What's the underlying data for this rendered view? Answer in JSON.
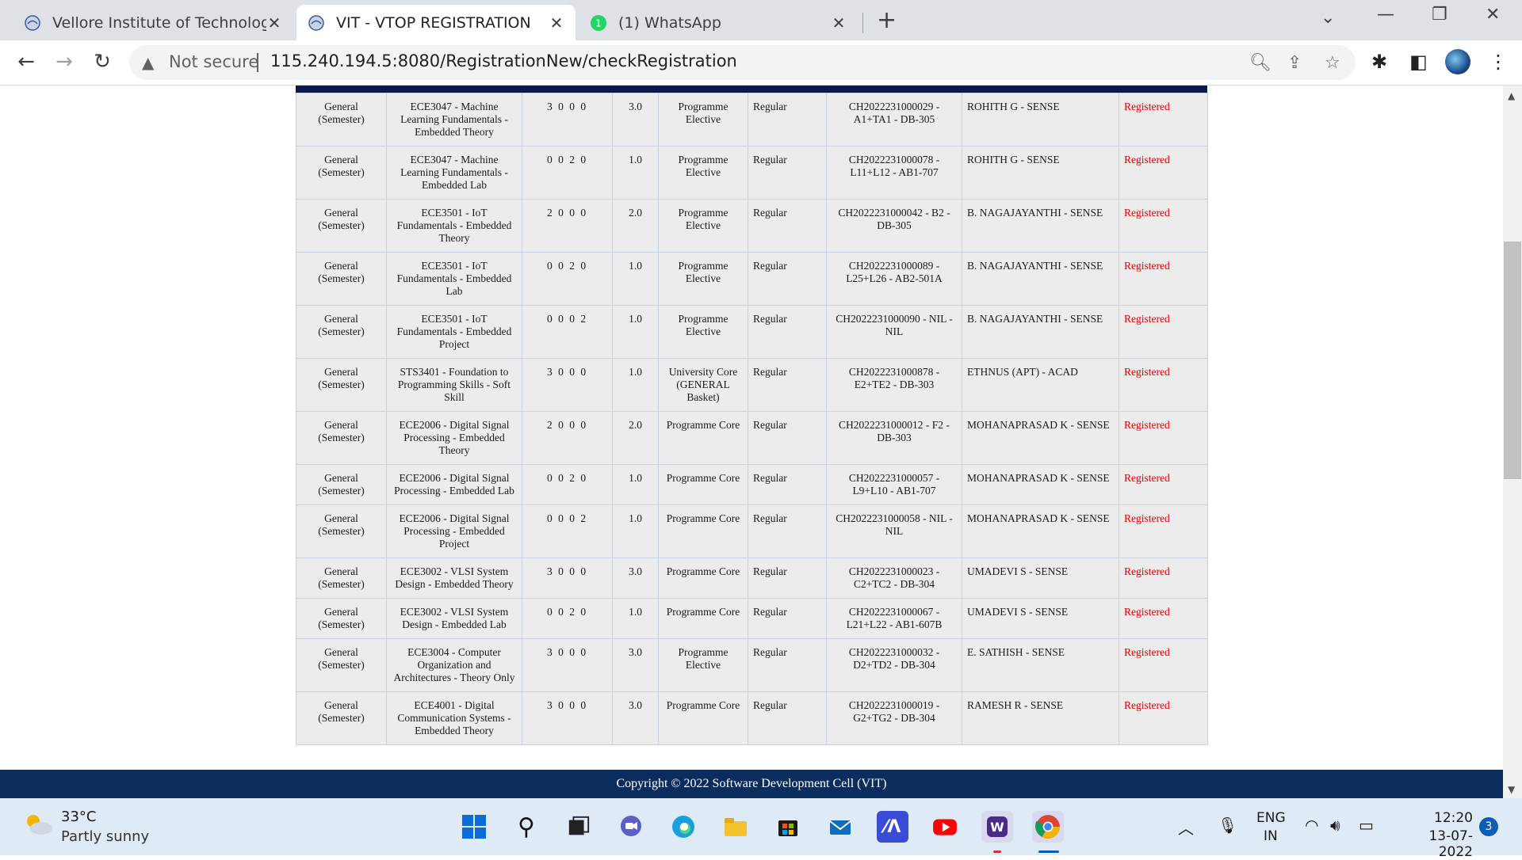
{
  "browser": {
    "tabs": [
      {
        "title": "Vellore Institute of Technology (V",
        "active": false
      },
      {
        "title": "VIT - VTOP REGISTRATION",
        "active": true
      },
      {
        "title": "(1) WhatsApp",
        "active": false,
        "badge": "1"
      }
    ],
    "new_tab": "+",
    "security_label": "Not secure",
    "url": "115.240.194.5:8080/RegistrationNew/checkRegistration"
  },
  "registration_rows": [
    {
      "type": "General (Semester)",
      "course": "ECE3047 - Machine Learning Fundamentals - Embedded Theory",
      "ltpjc": "3 0 0 0",
      "credits": "3.0",
      "category": "Programme Elective",
      "option": "Regular",
      "class": "CH2022231000029 - A1+TA1 - DB-305",
      "faculty": "ROHITH G - SENSE",
      "status": "Registered"
    },
    {
      "type": "General (Semester)",
      "course": "ECE3047 - Machine Learning Fundamentals - Embedded Lab",
      "ltpjc": "0 0 2 0",
      "credits": "1.0",
      "category": "Programme Elective",
      "option": "Regular",
      "class": "CH2022231000078 - L11+L12 - AB1-707",
      "faculty": "ROHITH G - SENSE",
      "status": "Registered"
    },
    {
      "type": "General (Semester)",
      "course": "ECE3501 - IoT Fundamentals - Embedded Theory",
      "ltpjc": "2 0 0 0",
      "credits": "2.0",
      "category": "Programme Elective",
      "option": "Regular",
      "class": "CH2022231000042 - B2 - DB-305",
      "faculty": "B. NAGAJAYANTHI - SENSE",
      "status": "Registered"
    },
    {
      "type": "General (Semester)",
      "course": "ECE3501 - IoT Fundamentals - Embedded Lab",
      "ltpjc": "0 0 2 0",
      "credits": "1.0",
      "category": "Programme Elective",
      "option": "Regular",
      "class": "CH2022231000089 - L25+L26 - AB2-501A",
      "faculty": "B. NAGAJAYANTHI - SENSE",
      "status": "Registered"
    },
    {
      "type": "General (Semester)",
      "course": "ECE3501 - IoT Fundamentals - Embedded Project",
      "ltpjc": "0 0 0 2",
      "credits": "1.0",
      "category": "Programme Elective",
      "option": "Regular",
      "class": "CH2022231000090 - NIL - NIL",
      "faculty": "B. NAGAJAYANTHI - SENSE",
      "status": "Registered"
    },
    {
      "type": "General (Semester)",
      "course": "STS3401 - Foundation to Programming Skills - Soft Skill",
      "ltpjc": "3 0 0 0",
      "credits": "1.0",
      "category": "University Core (GENERAL Basket)",
      "option": "Regular",
      "class": "CH2022231000878 - E2+TE2 - DB-303",
      "faculty": "ETHNUS (APT) - ACAD",
      "status": "Registered"
    },
    {
      "type": "General (Semester)",
      "course": "ECE2006 - Digital Signal Processing - Embedded Theory",
      "ltpjc": "2 0 0 0",
      "credits": "2.0",
      "category": "Programme Core",
      "option": "Regular",
      "class": "CH2022231000012 - F2 - DB-303",
      "faculty": "MOHANAPRASAD K - SENSE",
      "status": "Registered"
    },
    {
      "type": "General (Semester)",
      "course": "ECE2006 - Digital Signal Processing - Embedded Lab",
      "ltpjc": "0 0 2 0",
      "credits": "1.0",
      "category": "Programme Core",
      "option": "Regular",
      "class": "CH2022231000057 - L9+L10 - AB1-707",
      "faculty": "MOHANAPRASAD K - SENSE",
      "status": "Registered"
    },
    {
      "type": "General (Semester)",
      "course": "ECE2006 - Digital Signal Processing - Embedded Project",
      "ltpjc": "0 0 0 2",
      "credits": "1.0",
      "category": "Programme Core",
      "option": "Regular",
      "class": "CH2022231000058 - NIL - NIL",
      "faculty": "MOHANAPRASAD K - SENSE",
      "status": "Registered"
    },
    {
      "type": "General (Semester)",
      "course": "ECE3002 - VLSI System Design - Embedded Theory",
      "ltpjc": "3 0 0 0",
      "credits": "3.0",
      "category": "Programme Core",
      "option": "Regular",
      "class": "CH2022231000023 - C2+TC2 - DB-304",
      "faculty": "UMADEVI S - SENSE",
      "status": "Registered"
    },
    {
      "type": "General (Semester)",
      "course": "ECE3002 - VLSI System Design - Embedded Lab",
      "ltpjc": "0 0 2 0",
      "credits": "1.0",
      "category": "Programme Core",
      "option": "Regular",
      "class": "CH2022231000067 - L21+L22 - AB1-607B",
      "faculty": "UMADEVI S - SENSE",
      "status": "Registered"
    },
    {
      "type": "General (Semester)",
      "course": "ECE3004 - Computer Organization and Architectures - Theory Only",
      "ltpjc": "3 0 0 0",
      "credits": "3.0",
      "category": "Programme Elective",
      "option": "Regular",
      "class": "CH2022231000032 - D2+TD2 - DB-304",
      "faculty": "E. SATHISH - SENSE",
      "status": "Registered"
    },
    {
      "type": "General (Semester)",
      "course": "ECE4001 - Digital Communication Systems - Embedded Theory",
      "ltpjc": "3 0 0 0",
      "credits": "3.0",
      "category": "Programme Core",
      "option": "Regular",
      "class": "CH2022231000019 - G2+TG2 - DB-304",
      "faculty": "RAMESH R - SENSE",
      "status": "Registered"
    }
  ],
  "footer": "Copyright © 2022 Software Development Cell (VIT)",
  "taskbar": {
    "temperature": "33°C",
    "weather": "Partly sunny",
    "lang_line1": "ENG",
    "lang_line2": "IN",
    "time": "12:20",
    "date": "13-07-2022",
    "notifications": "3"
  },
  "colors": {
    "status_registered": "#e00000",
    "header_bar": "#0b1a4a",
    "footer_bg": "#0b2d5e"
  }
}
